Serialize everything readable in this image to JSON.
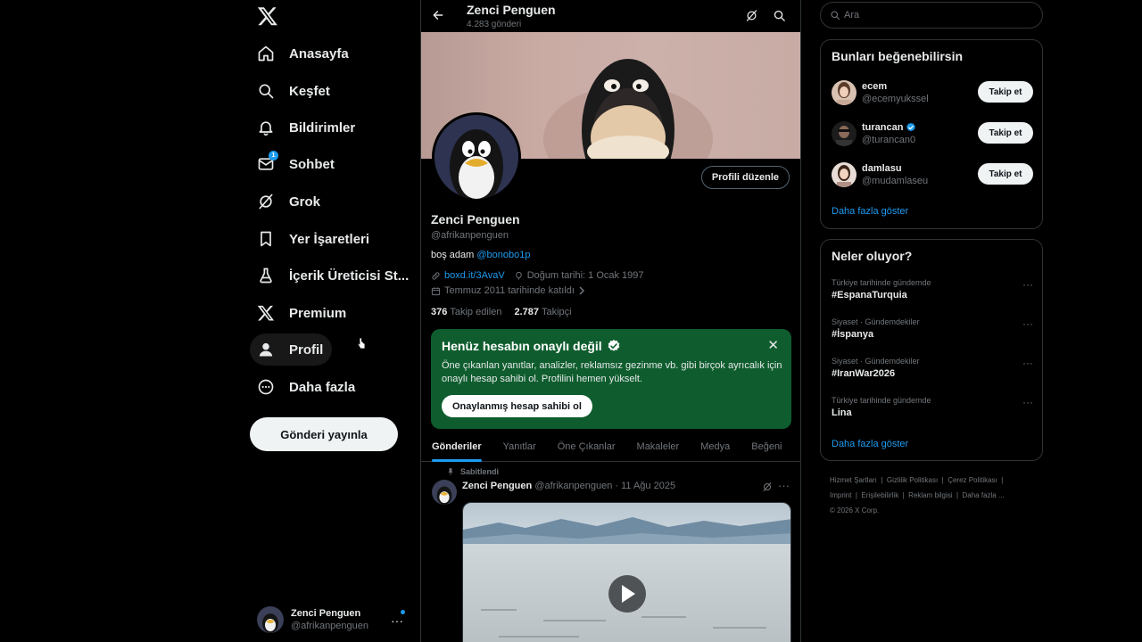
{
  "nav": {
    "items": [
      {
        "label": "Anasayfa",
        "icon": "home-icon"
      },
      {
        "label": "Keşfet",
        "icon": "search-icon"
      },
      {
        "label": "Bildirimler",
        "icon": "bell-icon"
      },
      {
        "label": "Sohbet",
        "icon": "mail-icon",
        "badge": "1"
      },
      {
        "label": "Grok",
        "icon": "grok-icon"
      },
      {
        "label": "Yer İşaretleri",
        "icon": "bookmark-icon"
      },
      {
        "label": "İçerik Üreticisi St...",
        "icon": "creator-studio-icon"
      },
      {
        "label": "Premium",
        "icon": "x-logo-icon"
      },
      {
        "label": "Profil",
        "icon": "person-icon"
      },
      {
        "label": "Daha fazla",
        "icon": "more-circle-icon"
      }
    ],
    "post_button": "Gönderi yayınla",
    "account": {
      "name": "Zenci Penguen",
      "handle": "@afrikanpenguen",
      "more": "···"
    }
  },
  "header": {
    "title": "Zenci Penguen",
    "subtitle": "4.283 gönderi"
  },
  "profile": {
    "name": "Zenci Penguen",
    "handle": "@afrikanpenguen",
    "edit_button": "Profili düzenle",
    "bio_text": "boş adam",
    "bio_mention": "@bonobo1p",
    "website": "boxd.it/3AvaV",
    "birthday": "Doğum tarihi: 1 Ocak 1997",
    "joined": "Temmuz 2011 tarihinde katıldı",
    "following_count": "376",
    "following_label": "Takip edilen",
    "followers_count": "2.787",
    "followers_label": "Takipçi"
  },
  "verify": {
    "title": "Henüz hesabın onaylı değil",
    "text": "Öne çıkanlan yanıtlar, analizler, reklamsız gezinme vb. gibi birçok ayrıcalık için onaylı hesap sahibi ol. Profilini hemen yükselt.",
    "button": "Onaylanmış hesap sahibi ol",
    "close": "✕"
  },
  "tabs": [
    "Gönderiler",
    "Yanıtlar",
    "Öne Çıkanlar",
    "Makaleler",
    "Medya",
    "Beğeni"
  ],
  "post": {
    "pinned": "Sabitlendi",
    "name": "Zenci Penguen",
    "meta": "@afrikanpenguen · 11 Ağu 2025",
    "more": "···"
  },
  "search": {
    "placeholder": "Ara"
  },
  "suggestions": {
    "title": "Bunları beğenebilirsin",
    "users": [
      {
        "name": "ecem",
        "handle": "@ecemyukssel",
        "button": "Takip et",
        "verified": false
      },
      {
        "name": "turancan",
        "handle": "@turancan0",
        "button": "Takip et",
        "verified": true
      },
      {
        "name": "damlasu",
        "handle": "@mudamlaseu",
        "button": "Takip et",
        "verified": false
      }
    ],
    "show_more": "Daha fazla göster"
  },
  "trends": {
    "title": "Neler oluyor?",
    "items": [
      {
        "context": "Türkiye tarihinde gündemde",
        "title": "#EspanaTurquia"
      },
      {
        "context": "Siyaset · Gündemdekiler",
        "title": "#İspanya"
      },
      {
        "context": "Siyaset · Gündemdekiler",
        "title": "#IranWar2026"
      },
      {
        "context": "Türkiye tarihinde gündemde",
        "title": "Lina"
      }
    ],
    "show_more": "Daha fazla göster",
    "dots": "···"
  },
  "footer": {
    "links": [
      "Hizmet Şartları",
      "Gizlilik Politikası",
      "Çerez Politikası",
      "Imprint",
      "Erişilebilirlik",
      "Reklam bilgisi",
      "Daha fazla ..."
    ],
    "copyright": "© 2026 X Corp."
  },
  "colors": {
    "accent": "#1d9bf0",
    "verify_card": "#0f5d2e",
    "background": "#000000",
    "border": "#2f3336"
  }
}
